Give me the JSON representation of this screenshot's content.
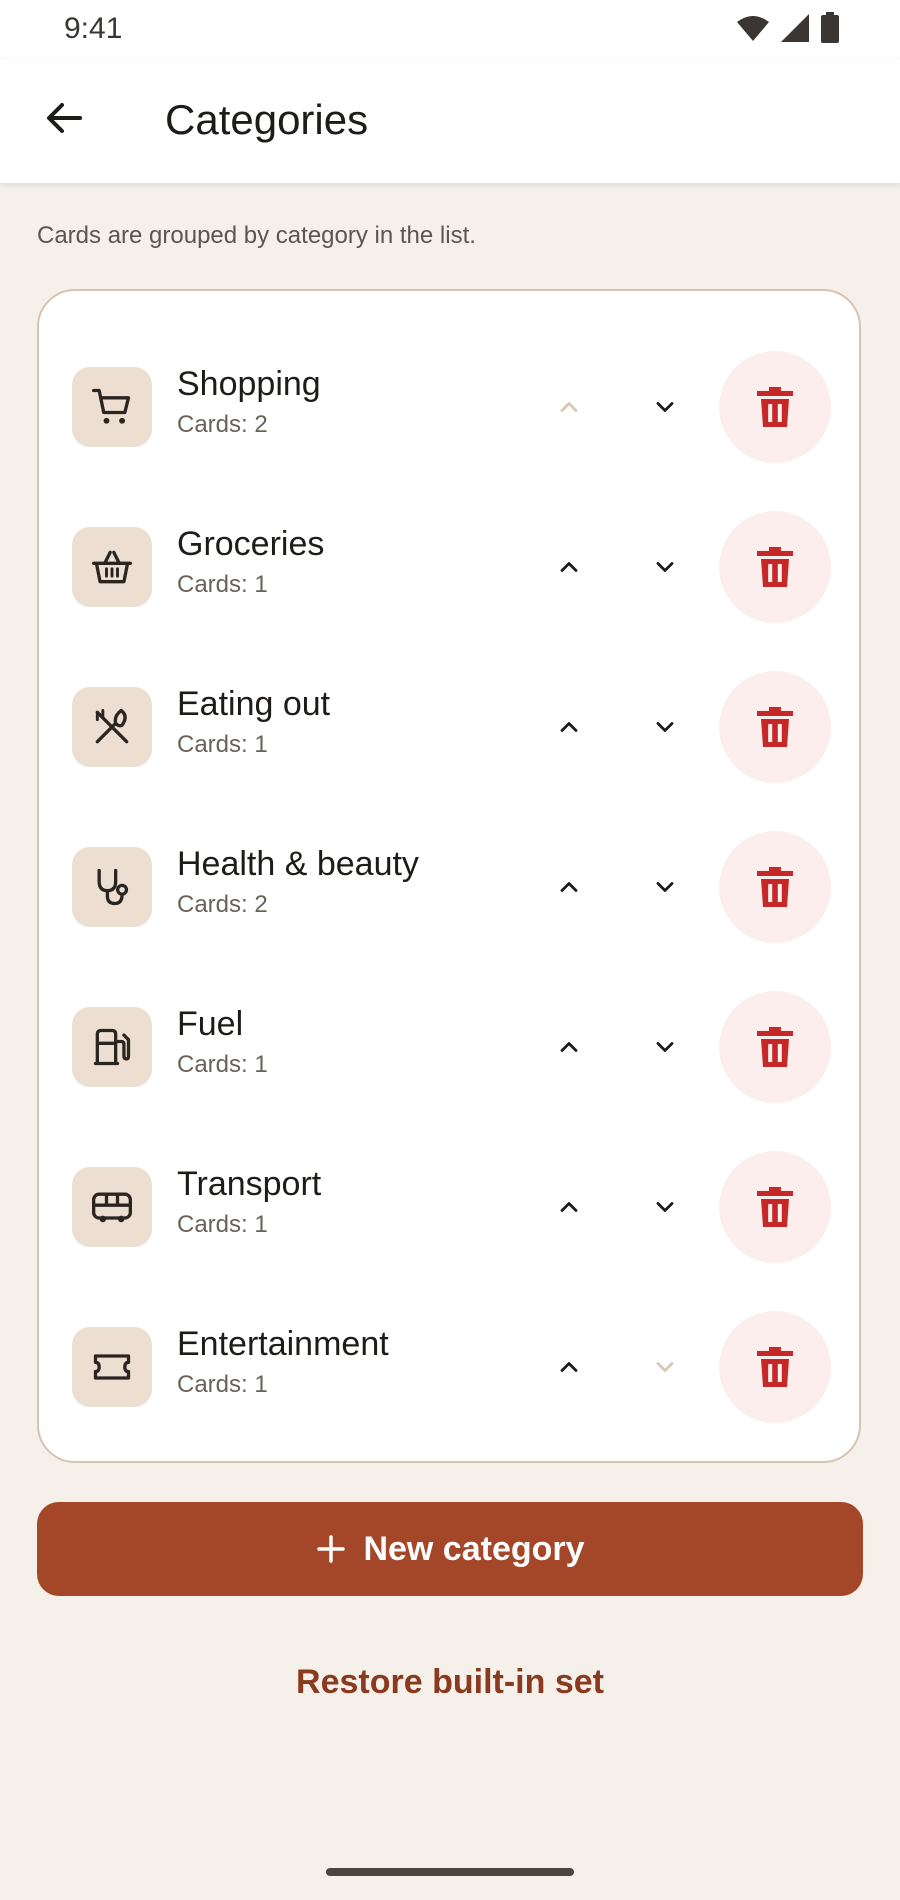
{
  "status_bar": {
    "time": "9:41",
    "icons": [
      "wifi-icon",
      "signal-icon",
      "battery-icon"
    ]
  },
  "header": {
    "title": "Categories",
    "back_icon": "arrow-left-icon"
  },
  "hint": "Cards are grouped by category in the list.",
  "categories": [
    {
      "name": "Shopping",
      "count": "Cards: 2",
      "icon": "cart-icon",
      "up_enabled": false,
      "down_enabled": true
    },
    {
      "name": "Groceries",
      "count": "Cards: 1",
      "icon": "basket-icon",
      "up_enabled": true,
      "down_enabled": true
    },
    {
      "name": "Eating out",
      "count": "Cards: 1",
      "icon": "utensils-icon",
      "up_enabled": true,
      "down_enabled": true
    },
    {
      "name": "Health & beauty",
      "count": "Cards: 2",
      "icon": "stethoscope-icon",
      "up_enabled": true,
      "down_enabled": true
    },
    {
      "name": "Fuel",
      "count": "Cards: 1",
      "icon": "fuel-pump-icon",
      "up_enabled": true,
      "down_enabled": true
    },
    {
      "name": "Transport",
      "count": "Cards: 1",
      "icon": "bus-icon",
      "up_enabled": true,
      "down_enabled": true
    },
    {
      "name": "Entertainment",
      "count": "Cards: 1",
      "icon": "ticket-icon",
      "up_enabled": true,
      "down_enabled": false
    }
  ],
  "actions": {
    "new_category": "New category",
    "restore": "Restore built-in set"
  },
  "colors": {
    "accent": "#a34728",
    "accent_text": "#8a3a1e",
    "delete": "#c62828",
    "delete_bg": "#fceeed",
    "icon_tile": "#ecdfd1",
    "disabled_arrow": "#d9c7b4",
    "background": "#f5f0ea"
  }
}
